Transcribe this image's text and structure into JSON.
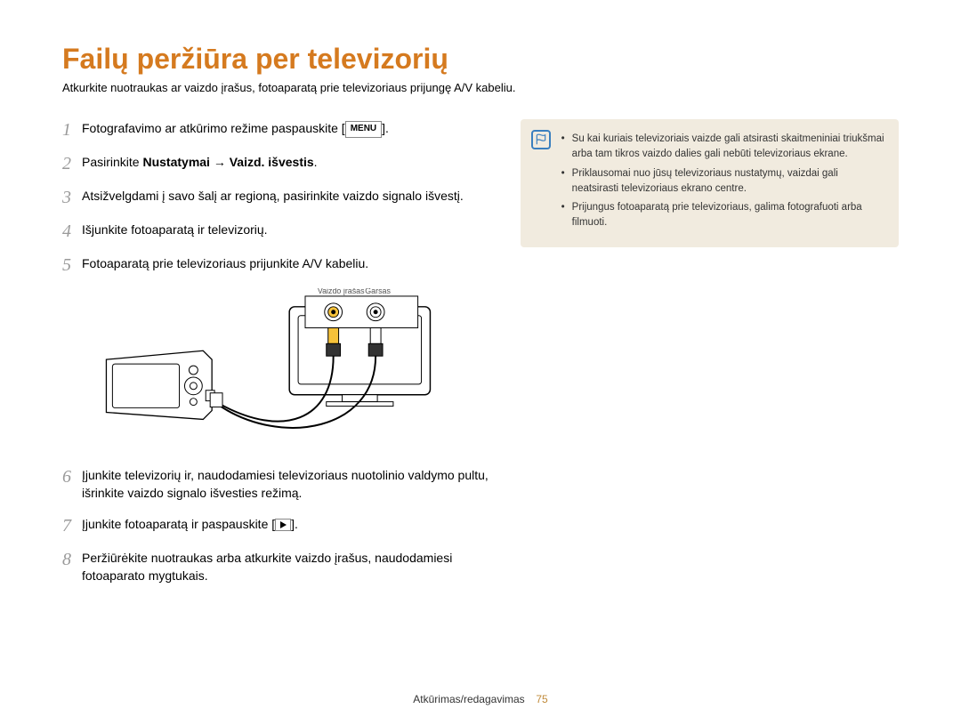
{
  "title": "Failų peržiūra per televizorių",
  "subtitle": "Atkurkite nuotraukas ar vaizdo įrašus, fotoaparatą prie televizoriaus prijungę A/V kabeliu.",
  "steps": {
    "s1": {
      "num": "1",
      "text_before": "Fotografavimo ar atkūrimo režime paspauskite [",
      "menu": "MENU",
      "text_after": "]."
    },
    "s2": {
      "num": "2",
      "text_before": "Pasirinkite ",
      "bold": "Nustatymai → Vaizd. išvestis",
      "text_after": "."
    },
    "s3": {
      "num": "3",
      "text": "Atsižvelgdami į savo šalį ar regioną, pasirinkite vaizdo signalo išvestį."
    },
    "s4": {
      "num": "4",
      "text": "Išjunkite fotoaparatą ir televizorių."
    },
    "s5": {
      "num": "5",
      "text": "Fotoaparatą prie televizoriaus prijunkite A/V kabeliu."
    },
    "s6": {
      "num": "6",
      "text": "Įjunkite televizorių ir, naudodamiesi televizoriaus nuotolinio valdymo pultu, išrinkite vaizdo signalo išvesties režimą."
    },
    "s7": {
      "num": "7",
      "text_before": "Įjunkite fotoaparatą ir paspauskite [",
      "text_after": "]."
    },
    "s8": {
      "num": "8",
      "text": "Peržiūrėkite nuotraukas arba atkurkite vaizdo įrašus, naudodamiesi fotoaparato mygtukais."
    }
  },
  "diagram": {
    "label_video": "Vaizdo įrašas",
    "label_audio": "Garsas"
  },
  "notes": {
    "n1": "Su kai kuriais televizoriais vaizde gali atsirasti skaitmeniniai triukšmai arba tam tikros vaizdo dalies gali nebūti televizoriaus ekrane.",
    "n2": "Priklausomai nuo jūsų televizoriaus nustatymų, vaizdai gali neatsirasti televizoriaus ekrano centre.",
    "n3": "Prijungus fotoaparatą prie televizoriaus, galima fotografuoti arba filmuoti."
  },
  "footer": {
    "section": "Atkūrimas/redagavimas",
    "page": "75"
  }
}
